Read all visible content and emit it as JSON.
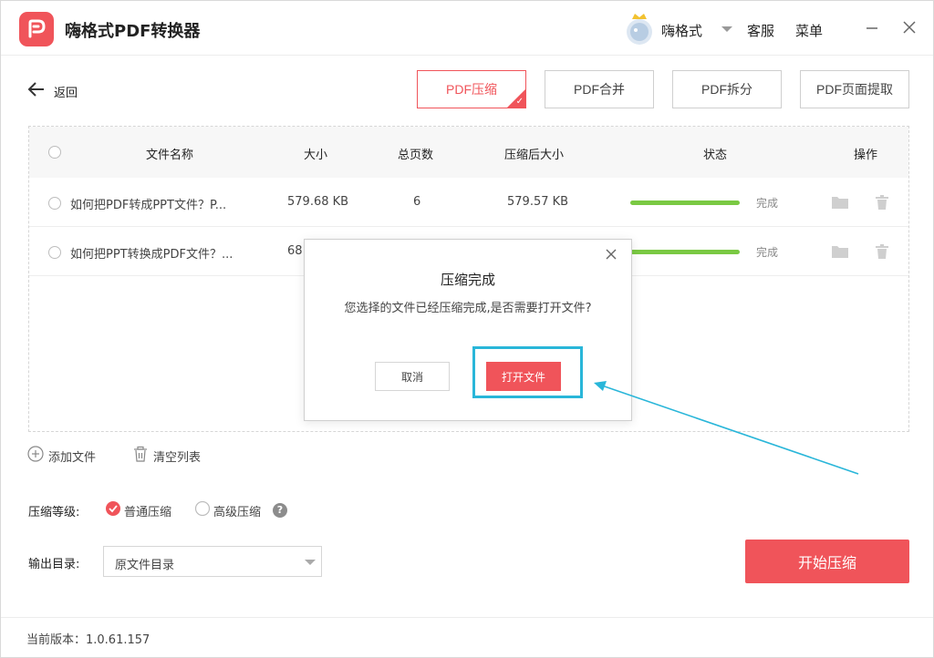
{
  "app": {
    "title": "嗨格式PDF转换器"
  },
  "user": {
    "name": "嗨格式"
  },
  "header": {
    "service_label": "客服",
    "menu_label": "菜单"
  },
  "toolbar": {
    "back_label": "返回",
    "modes": [
      {
        "label": "PDF压缩",
        "active": true
      },
      {
        "label": "PDF合并",
        "active": false
      },
      {
        "label": "PDF拆分",
        "active": false
      },
      {
        "label": "PDF页面提取",
        "active": false
      }
    ]
  },
  "table": {
    "columns": {
      "name": "文件名称",
      "size": "大小",
      "pages": "总页数",
      "compressed": "压缩后大小",
      "status": "状态",
      "ops": "操作"
    },
    "rows": [
      {
        "name": "如何把PDF转成PPT文件？P...",
        "size": "579.68 KB",
        "pages": "6",
        "compressed": "579.57 KB",
        "progress": 1.0,
        "status": "完成"
      },
      {
        "name": "如何把PPT转换成PDF文件？...",
        "size": "68",
        "pages": "",
        "compressed": "",
        "progress": 1.0,
        "status": "完成"
      }
    ]
  },
  "actions": {
    "add_file": "添加文件",
    "clear_list": "清空列表"
  },
  "settings": {
    "level_label": "压缩等级:",
    "level_options": [
      {
        "label": "普通压缩",
        "selected": true
      },
      {
        "label": "高级压缩",
        "selected": false
      }
    ],
    "help_mark": "?",
    "output_label": "输出目录:",
    "output_value": "原文件目录"
  },
  "start_button": "开始压缩",
  "footer": {
    "version": "当前版本：1.0.61.157"
  },
  "dialog": {
    "title": "压缩完成",
    "message": "您选择的文件已经压缩完成,是否需要打开文件?",
    "cancel_label": "取消",
    "open_label": "打开文件"
  },
  "colors": {
    "accent": "#f0545a",
    "progress": "#7ac943",
    "highlight": "#29b6d9"
  }
}
